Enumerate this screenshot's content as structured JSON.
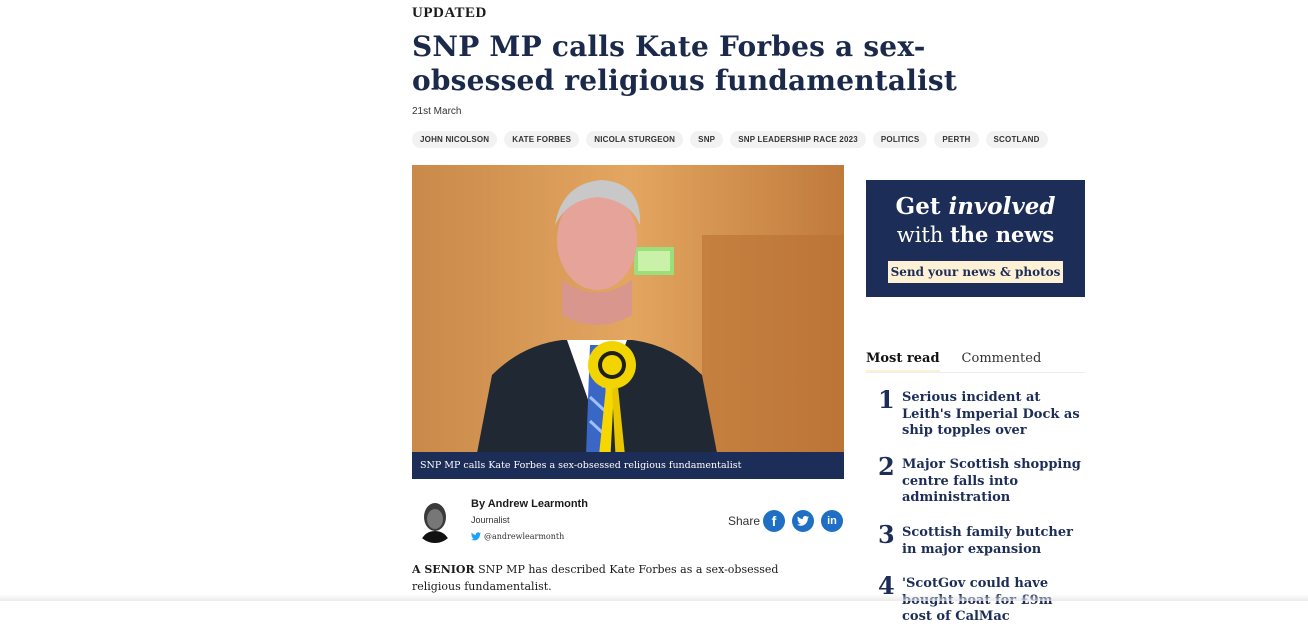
{
  "article": {
    "updated_label": "UPDATED",
    "headline": "SNP MP calls Kate Forbes a sex-obsessed religious fundamentalist",
    "date": "21st March",
    "tags": [
      "JOHN NICOLSON",
      "KATE FORBES",
      "NICOLA STURGEON",
      "SNP",
      "SNP LEADERSHIP RACE 2023",
      "POLITICS",
      "PERTH",
      "SCOTLAND"
    ],
    "image_caption": "SNP MP calls Kate Forbes a sex-obsessed religious fundamentalist",
    "author": {
      "byline": "By Andrew Learmonth",
      "role": "Journalist",
      "twitter": "@andrewlearmonth"
    },
    "share_label": "Share",
    "body_lead": "A SENIOR",
    "body_text": " SNP MP has described Kate Forbes as a sex-obsessed religious fundamentalist."
  },
  "promo": {
    "get": "Get",
    "involved": "involved",
    "with": "with",
    "the_news": "the news",
    "button": "Send your news & photos"
  },
  "sidebar": {
    "tabs": [
      "Most read",
      "Commented"
    ],
    "most_read": [
      {
        "rank": "1",
        "title": "Serious incident at Leith's Imperial Dock as ship topples over"
      },
      {
        "rank": "2",
        "title": "Major Scottish shopping centre falls into administration"
      },
      {
        "rank": "3",
        "title": "Scottish family butcher in major expansion"
      },
      {
        "rank": "4",
        "title": "'ScotGov could have bought boat for £9m cost of CalMac"
      }
    ]
  },
  "colors": {
    "navy": "#1c2d57",
    "cream": "#fff1d6",
    "social_blue": "#1f6fc5"
  }
}
